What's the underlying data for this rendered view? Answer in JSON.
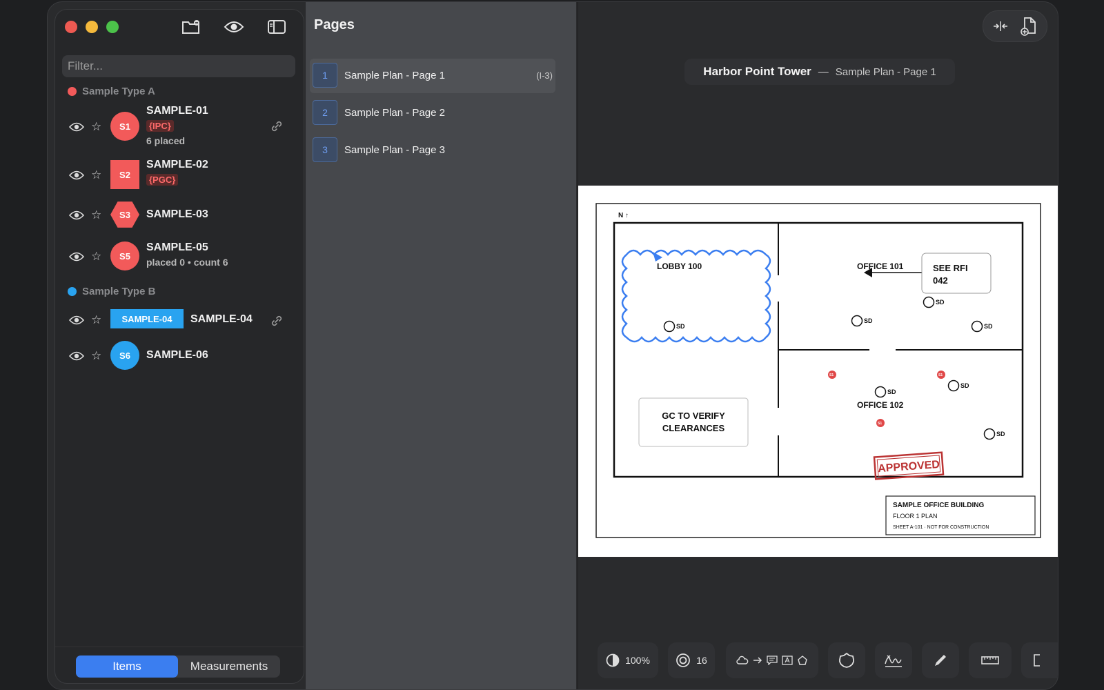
{
  "sidebar": {
    "filter_placeholder": "Filter...",
    "groups": [
      {
        "name": "Sample Type A",
        "color": "#f25a5a"
      },
      {
        "name": "Sample Type B",
        "color": "#29a3f0"
      }
    ],
    "items": [
      {
        "name": "SAMPLE-01",
        "badge": "S1",
        "tag": "{IPC}",
        "sub": "6 placed"
      },
      {
        "name": "SAMPLE-02",
        "badge": "S2",
        "tag": "{PGC}"
      },
      {
        "name": "SAMPLE-03",
        "badge": "S3"
      },
      {
        "name": "SAMPLE-05",
        "badge": "S5",
        "sub": "placed 0 • count 6"
      },
      {
        "name": "SAMPLE-04",
        "badge": "SAMPLE-04"
      },
      {
        "name": "SAMPLE-06",
        "badge": "S6"
      }
    ],
    "tabs": {
      "items": "Items",
      "measurements": "Measurements"
    }
  },
  "pages": {
    "title": "Pages",
    "list": [
      {
        "num": "1",
        "label": "Sample Plan - Page 1",
        "range": "(I-3)"
      },
      {
        "num": "2",
        "label": "Sample Plan - Page 2"
      },
      {
        "num": "3",
        "label": "Sample Plan - Page 3"
      }
    ]
  },
  "viewer": {
    "project": "Harbor Point Tower",
    "dash": "—",
    "page": "Sample Plan - Page 1",
    "plan": {
      "north": "N ↑",
      "lobby": "LOBBY 100",
      "office101": "OFFICE 101",
      "office102": "OFFICE 102",
      "sd": "SD",
      "rfi_line1": "SEE RFI",
      "rfi_line2": "042",
      "gc_line1": "GC TO VERIFY",
      "gc_line2": "CLEARANCES",
      "stamp": "APPROVED",
      "marker": "S1",
      "tb_title": "SAMPLE OFFICE BUILDING",
      "tb_sub": "FLOOR 1 PLAN",
      "tb_sheet": "SHEET A-101  ·  NOT FOR CONSTRUCTION"
    },
    "toolbar": {
      "opacity": "100%",
      "count": "16"
    }
  }
}
